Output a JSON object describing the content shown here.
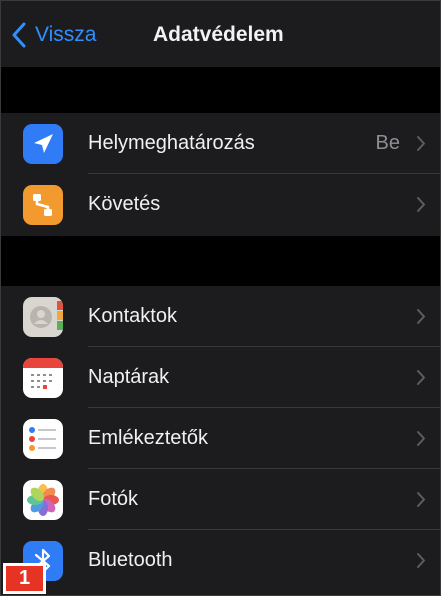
{
  "nav": {
    "back_label": "Vissza",
    "title": "Adatvédelem"
  },
  "groups": [
    {
      "rows": [
        {
          "label": "Helymeghatározás",
          "value": "Be",
          "icon": "location-arrow-icon",
          "icon_color": "#2f7cf6"
        },
        {
          "label": "Követés",
          "value": "",
          "icon": "tracking-icon",
          "icon_color": "#f29a2e"
        }
      ]
    },
    {
      "rows": [
        {
          "label": "Kontaktok",
          "value": "",
          "icon": "contacts-icon",
          "icon_color": "#d9d6d0"
        },
        {
          "label": "Naptárak",
          "value": "",
          "icon": "calendar-icon",
          "icon_color": "#ffffff"
        },
        {
          "label": "Emlékeztetők",
          "value": "",
          "icon": "reminders-icon",
          "icon_color": "#ffffff"
        },
        {
          "label": "Fotók",
          "value": "",
          "icon": "photos-icon",
          "icon_color": "#ffffff"
        },
        {
          "label": "Bluetooth",
          "value": "",
          "icon": "bluetooth-icon",
          "icon_color": "#2f7cf6"
        }
      ]
    }
  ],
  "badge": {
    "label": "1"
  },
  "colors": {
    "accent": "#2f8fff",
    "background": "#000000",
    "cell": "#1c1c1e",
    "badge": "#e63324"
  }
}
